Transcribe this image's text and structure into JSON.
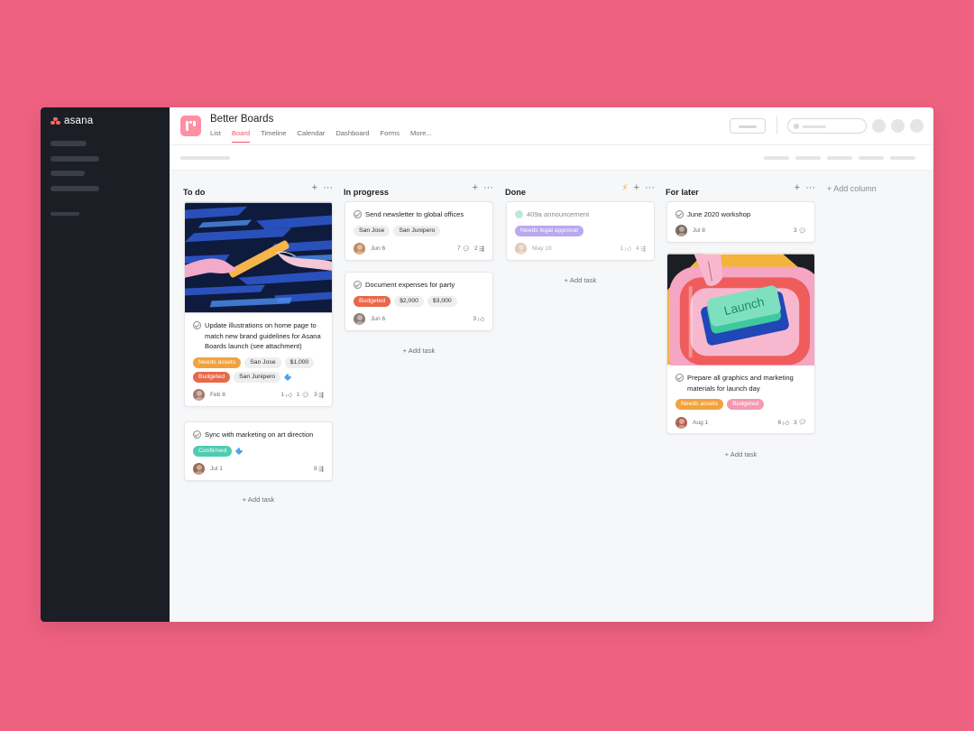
{
  "sidebar": {
    "logo_text": "asana"
  },
  "project": {
    "title": "Better Boards",
    "tabs": [
      {
        "label": "List",
        "active": false
      },
      {
        "label": "Board",
        "active": true
      },
      {
        "label": "Timeline",
        "active": false
      },
      {
        "label": "Calendar",
        "active": false
      },
      {
        "label": "Dashboard",
        "active": false
      },
      {
        "label": "Forms",
        "active": false
      },
      {
        "label": "More..."
      }
    ]
  },
  "colors": {
    "accent": "#ef5470",
    "background": "#ef6181",
    "sidebar": "#1b1e24"
  },
  "board": {
    "add_column_label": "+ Add column",
    "add_task_label": "Add task",
    "columns": [
      {
        "title": "To do",
        "cards": [
          {
            "title": "Update illustrations on home page to match new brand guidelines for Asana Boards launch (see attachment)",
            "image": "relay-baton-illustration",
            "tags": [
              "Needs assets",
              "San Jose",
              "$1,000",
              "Budgeted",
              "San Junipero"
            ],
            "date": "Feb 8",
            "likes": "1",
            "comments": "1",
            "subtasks": "3"
          },
          {
            "title": "Sync with marketing on art direction",
            "tags": [
              "Confirmed"
            ],
            "date": "Jul 1",
            "subtasks": "8"
          }
        ]
      },
      {
        "title": "In progress",
        "cards": [
          {
            "title": "Send newsletter to global offices",
            "tags": [
              "San Jose",
              "San Junipero"
            ],
            "date": "Jun 6",
            "comments": "7",
            "subtasks": "2"
          },
          {
            "title": "Document expenses for party",
            "tags": [
              "Budgeted",
              "$2,000",
              "$3,000"
            ],
            "date": "Jun 6",
            "likes": "3"
          }
        ]
      },
      {
        "title": "Done",
        "cards": [
          {
            "title": "409a announcement",
            "tags": [
              "Needs legal approval"
            ],
            "date": "May 19",
            "likes": "1",
            "subtasks": "4"
          }
        ]
      },
      {
        "title": "For later",
        "cards": [
          {
            "title": "June 2020 workshop",
            "date": "Jul 8",
            "comments": "3"
          },
          {
            "title": "Prepare all graphics and marketing materials for launch day",
            "image": "launch-button-illustration",
            "image_text": "Launch",
            "tags": [
              "Needs assets",
              "Budgeted"
            ],
            "date": "Aug 1",
            "likes": "6",
            "comments": "3"
          }
        ]
      }
    ]
  }
}
